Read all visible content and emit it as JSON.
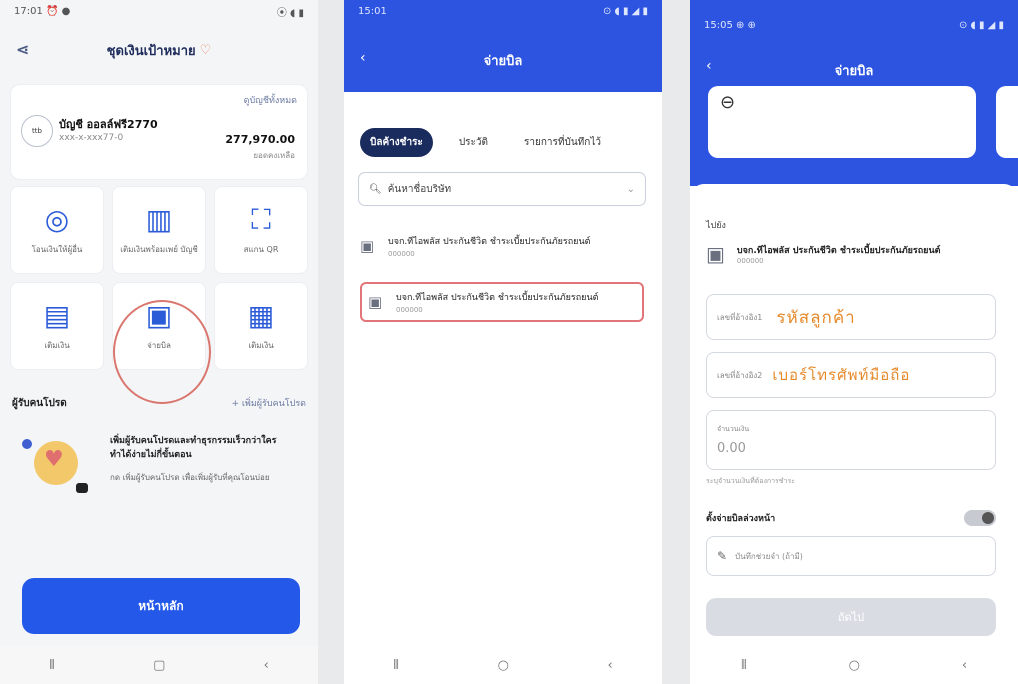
{
  "phone1": {
    "status": {
      "time": "17:01 ⏰ ●",
      "icons": "⦿ ◖ ▮"
    },
    "header_title": "ชุดเงินเป้าหมาย",
    "account": {
      "more_link": "ดูบัญชีทั้งหมด",
      "logo_text": "ttb",
      "name": "บัญชี ออลล์ฟรี2770",
      "number": "xxx-x-xxx77-0",
      "balance": "277,970.00",
      "balance_caption": "ยอดคงเหลือ"
    },
    "tiles": [
      {
        "icon": "account-icon",
        "glyph": "◎",
        "label": "โอนเงินให้ผู้อื่น"
      },
      {
        "icon": "transfer-phone-icon",
        "glyph": "▥",
        "label": "เติมเงินพร้อมเพย์ บัญชี"
      },
      {
        "icon": "scan-icon",
        "glyph": "⛶",
        "label": "สแกน QR"
      },
      {
        "icon": "topup-icon",
        "glyph": "▤",
        "label": "เติมเงิน"
      },
      {
        "icon": "bill-icon",
        "glyph": "▣",
        "label": "จ่ายบิล"
      },
      {
        "icon": "wallet-icon",
        "glyph": "▦",
        "label": "เติมเงิน"
      }
    ],
    "section": {
      "title": "ผู้รับคนโปรด",
      "link": "+ เพิ่มผู้รับคนโปรด"
    },
    "promo": {
      "title": "เพิ่มผู้รับคนโปรดและทำธุรกรรมเร็วกว่าใคร ทำได้ง่ายไม่กี่ขั้นตอน",
      "subtitle": "กด เพิ่มผู้รับคนโปรด เพื่อเพิ่มผู้รับที่คุณโอนบ่อย"
    },
    "main_button": "หน้าหลัก",
    "nav": [
      "⦀",
      "▢",
      "‹"
    ]
  },
  "phone2": {
    "status": {
      "time": "15:01",
      "icons": "⊙ ◖ ▮ ◢ ▮"
    },
    "title": "จ่ายบิล",
    "tabs": [
      "บิลค้างชำระ",
      "ประวัติ",
      "รายการที่บันทึกไว้"
    ],
    "search_text": "ค้นหาชื่อบริษัท",
    "items": [
      {
        "title": "บจก.ทีไอพลัส ประกันชีวิต ชำระเบี้ยประกันภัยรถยนต์",
        "sub": "000000"
      },
      {
        "title": "บจก.ทีไอพลัส ประกันชีวิต ชำระเบี้ยประกันภัยรถยนต์",
        "sub": "000000"
      }
    ],
    "nav": [
      "⦀",
      "○",
      "‹"
    ]
  },
  "phone3": {
    "status": {
      "time": "15:05 ⊕ ⊕",
      "icons": "⊙ ◖ ▮ ◢ ▮"
    },
    "title": "จ่ายบิล",
    "to_label": "ไปยัง",
    "biller_title": "บจก.ทีไอพลัส ประกันชีวิต ชำระเบี้ยประกันภัยรถยนต์",
    "biller_sub": "000000",
    "field1_label": "เลขที่อ้างอิง1",
    "field1_hint": "รหัสลูกค้า",
    "field2_label": "เลขที่อ้างอิง2",
    "field2_hint": "เบอร์โทรศัพท์มือถือ",
    "amount_label": "จำนวนเงิน",
    "amount_value": "0.00",
    "amount_hint": "ระบุจำนวนเงินที่ต้องการชำระ",
    "schedule_label": "ตั้งจ่ายบิลล่วงหน้า",
    "note_placeholder": "บันทึกช่วยจำ (ถ้ามี)",
    "next_button": "ถัดไป",
    "nav": [
      "⦀",
      "○",
      "‹"
    ]
  }
}
